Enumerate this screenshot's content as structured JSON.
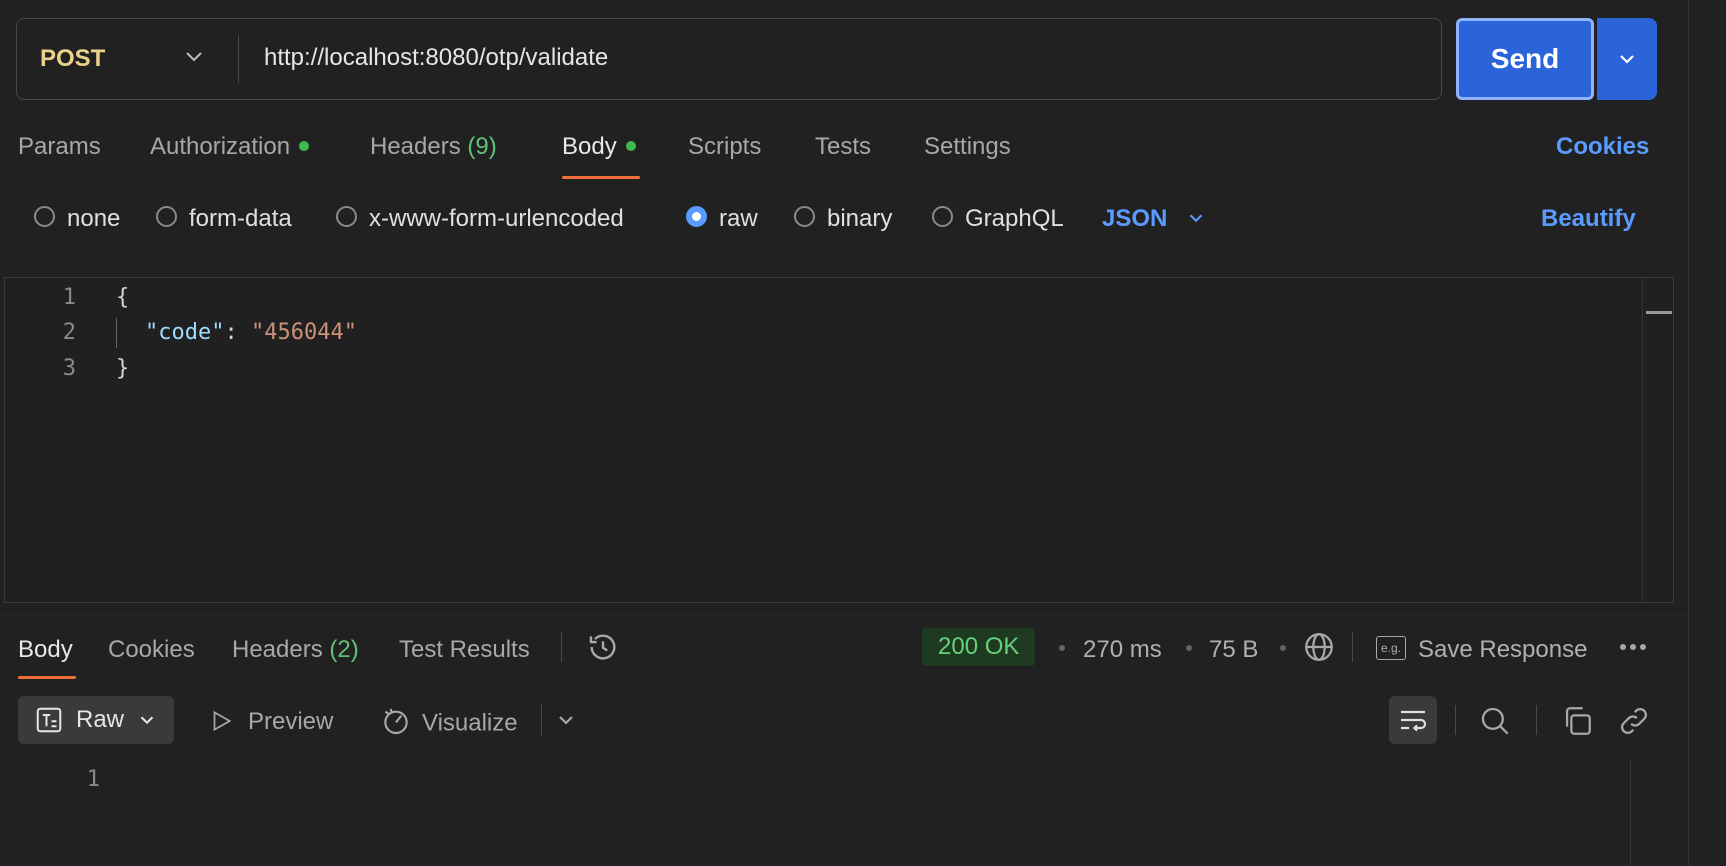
{
  "request": {
    "method": "POST",
    "url": "http://localhost:8080/otp/validate",
    "send_label": "Send"
  },
  "tabs": {
    "params": "Params",
    "authorization": "Authorization",
    "headers": "Headers",
    "headers_count": "(9)",
    "body": "Body",
    "scripts": "Scripts",
    "tests": "Tests",
    "settings": "Settings",
    "cookies": "Cookies"
  },
  "body_types": {
    "none": "none",
    "form_data": "form-data",
    "urlencoded": "x-www-form-urlencoded",
    "raw": "raw",
    "binary": "binary",
    "graphql": "GraphQL",
    "selected": "raw",
    "format": "JSON",
    "beautify": "Beautify"
  },
  "editor": {
    "line_numbers": [
      "1",
      "2",
      "3"
    ],
    "open_brace": "{",
    "key": "\"code\"",
    "colon": ": ",
    "value": "\"456044\"",
    "close_brace": "}"
  },
  "response": {
    "tabs": {
      "body": "Body",
      "cookies": "Cookies",
      "headers": "Headers",
      "headers_count": "(2)",
      "test_results": "Test Results"
    },
    "status": "200 OK",
    "time": "270 ms",
    "size": "75 B",
    "save_response": "Save Response",
    "view_mode": "Raw",
    "preview": "Preview",
    "visualize": "Visualize",
    "line_numbers": [
      "1"
    ]
  },
  "colors": {
    "accent_blue": "#2a64d8",
    "link_blue": "#5a9bff",
    "active_tab_underline": "#f06d3c",
    "status_green": "#66d17c",
    "method_yellow": "#ead28a"
  }
}
